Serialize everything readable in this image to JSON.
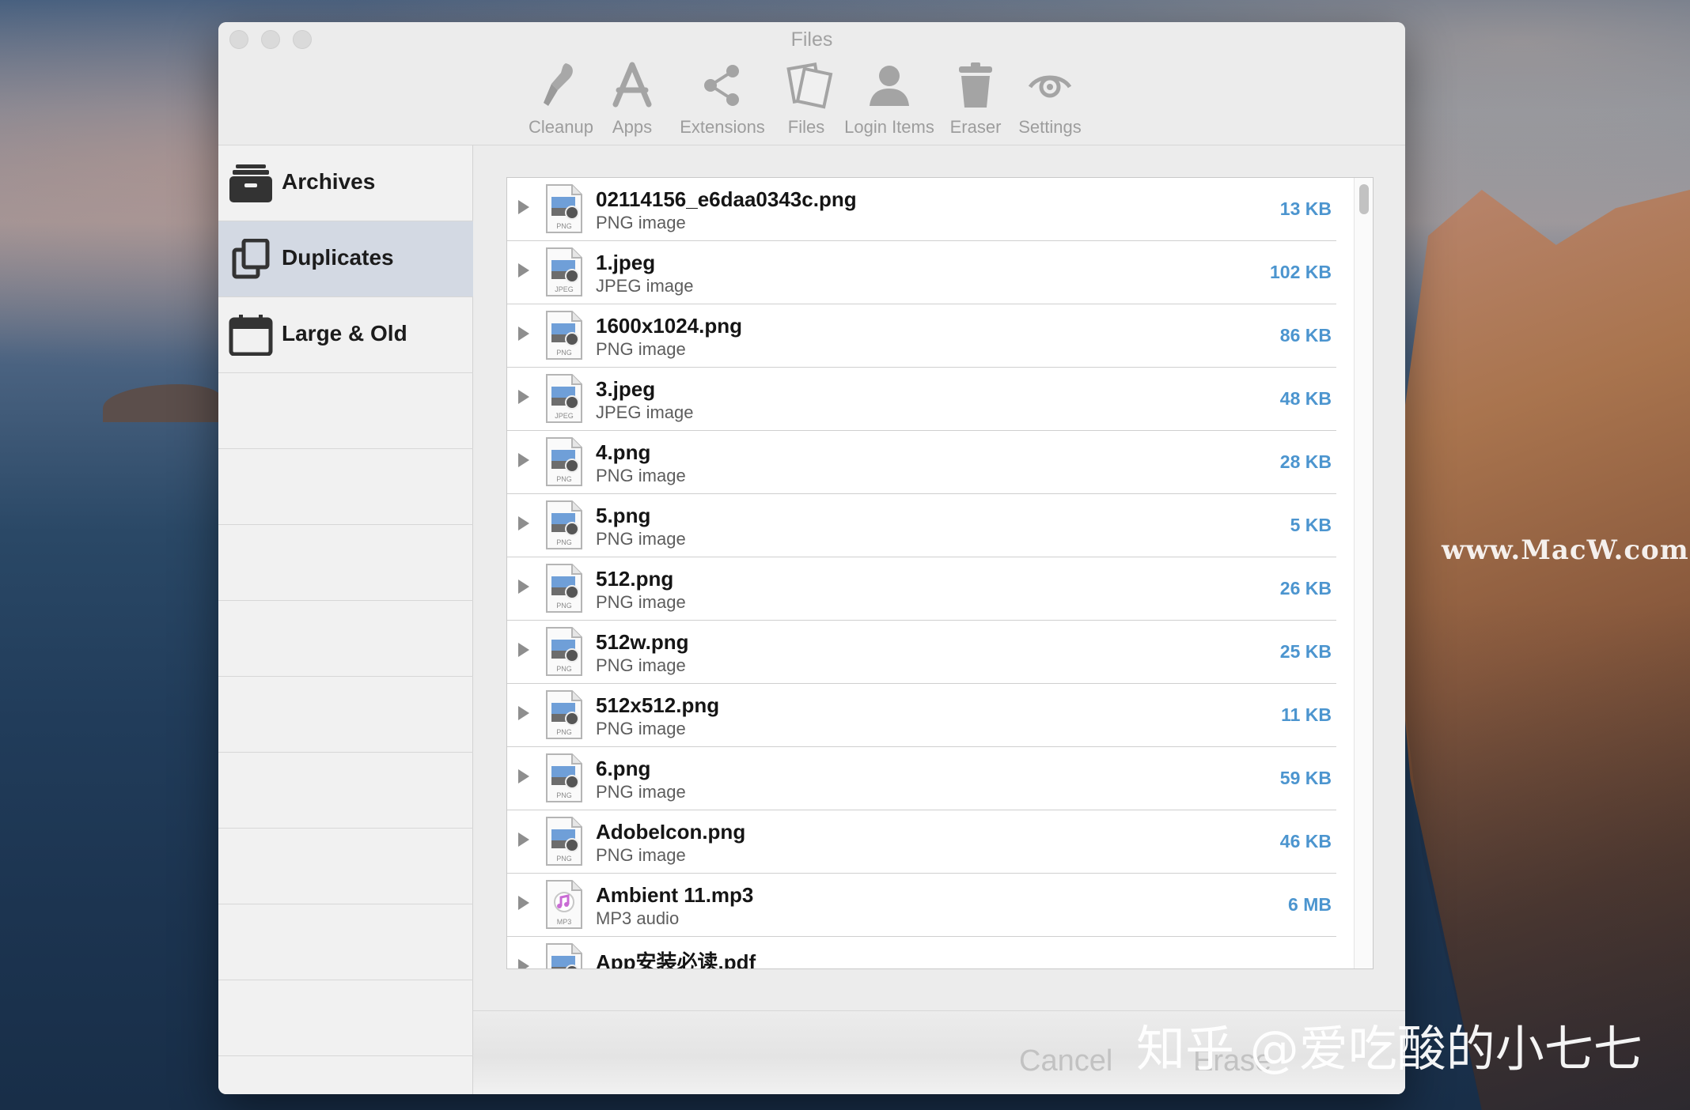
{
  "window": {
    "title": "Files"
  },
  "toolbar": {
    "items": [
      {
        "label": "Cleanup",
        "icon": "broom-icon"
      },
      {
        "label": "Apps",
        "icon": "app-store-icon"
      },
      {
        "label": "Extensions",
        "icon": "share-icon"
      },
      {
        "label": "Files",
        "icon": "files-icon"
      },
      {
        "label": "Login Items",
        "icon": "user-icon"
      },
      {
        "label": "Eraser",
        "icon": "trash-icon"
      },
      {
        "label": "Settings",
        "icon": "eye-settings-icon"
      }
    ]
  },
  "sidebar": {
    "items": [
      {
        "label": "Archives",
        "icon": "archive-box-icon",
        "selected": false
      },
      {
        "label": "Duplicates",
        "icon": "duplicate-icon",
        "selected": true
      },
      {
        "label": "Large & Old",
        "icon": "calendar-icon",
        "selected": false
      }
    ]
  },
  "files": [
    {
      "name": "02114156_e6daa0343c.png",
      "type": "PNG image",
      "size": "13 KB",
      "badge": "PNG"
    },
    {
      "name": "1.jpeg",
      "type": "JPEG image",
      "size": "102 KB",
      "badge": "JPEG"
    },
    {
      "name": "1600x1024.png",
      "type": "PNG image",
      "size": "86 KB",
      "badge": "PNG"
    },
    {
      "name": "3.jpeg",
      "type": "JPEG image",
      "size": "48 KB",
      "badge": "JPEG"
    },
    {
      "name": "4.png",
      "type": "PNG image",
      "size": "28 KB",
      "badge": "PNG"
    },
    {
      "name": "5.png",
      "type": "PNG image",
      "size": "5 KB",
      "badge": "PNG"
    },
    {
      "name": "512.png",
      "type": "PNG image",
      "size": "26 KB",
      "badge": "PNG"
    },
    {
      "name": "512w.png",
      "type": "PNG image",
      "size": "25 KB",
      "badge": "PNG"
    },
    {
      "name": "512x512.png",
      "type": "PNG image",
      "size": "11 KB",
      "badge": "PNG"
    },
    {
      "name": "6.png",
      "type": "PNG image",
      "size": "59 KB",
      "badge": "PNG"
    },
    {
      "name": "AdobeIcon.png",
      "type": "PNG image",
      "size": "46 KB",
      "badge": "PNG"
    },
    {
      "name": "Ambient 11.mp3",
      "type": "MP3 audio",
      "size": "6 MB",
      "badge": "MP3"
    },
    {
      "name": "App安装必读.pdf",
      "type": "",
      "size": "",
      "badge": ""
    }
  ],
  "footer": {
    "cancel_label": "Cancel",
    "erase_label": "Erase"
  },
  "watermarks": {
    "site": "www.MacW.com",
    "zhihu": "知乎 @爱吃酸的小七七"
  },
  "colors": {
    "accent_size": "#4c95cf",
    "sidebar_selected": "#d3d9e3"
  }
}
